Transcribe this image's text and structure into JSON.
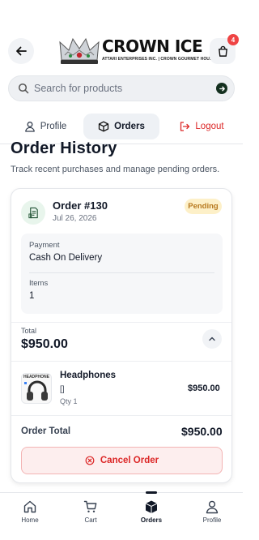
{
  "header": {
    "logo_title": "CROWN ICE",
    "logo_subtitle": "ATTARI ENTERPRISES INC. | CROWN GOURMET HOUSE",
    "cart_count": "4"
  },
  "search": {
    "placeholder": "Search for products"
  },
  "tabs": [
    {
      "label": "Profile",
      "icon": "user-icon"
    },
    {
      "label": "Orders",
      "icon": "box-icon",
      "active": true
    },
    {
      "label": "Logout",
      "icon": "logout-icon"
    }
  ],
  "page": {
    "title": "Order History",
    "subtitle": "Track recent purchases and manage pending orders."
  },
  "order": {
    "number": "Order #130",
    "date": "Jul 26, 2026",
    "status": "Pending",
    "payment_label": "Payment",
    "payment_value": "Cash On Delivery",
    "items_label": "Items",
    "items_value": "1",
    "total_label": "Total",
    "total_value": "$950.00",
    "line_items": [
      {
        "name": "Headphones",
        "variant": "[]",
        "qty": "Qty 1",
        "price": "$950.00",
        "thumb_text": "HEADPHONE"
      }
    ],
    "order_total_label": "Order Total",
    "order_total_value": "$950.00",
    "cancel_label": "Cancel Order"
  },
  "bottom_nav": [
    {
      "label": "Home",
      "icon": "home-icon"
    },
    {
      "label": "Cart",
      "icon": "cart-icon"
    },
    {
      "label": "Orders",
      "icon": "box-icon",
      "active": true
    },
    {
      "label": "Profile",
      "icon": "user-icon"
    }
  ],
  "colors": {
    "accent_dark_green": "#14301f",
    "pending_bg": "#fdf0c8",
    "pending_text": "#b7791f",
    "danger": "#dc2626"
  }
}
